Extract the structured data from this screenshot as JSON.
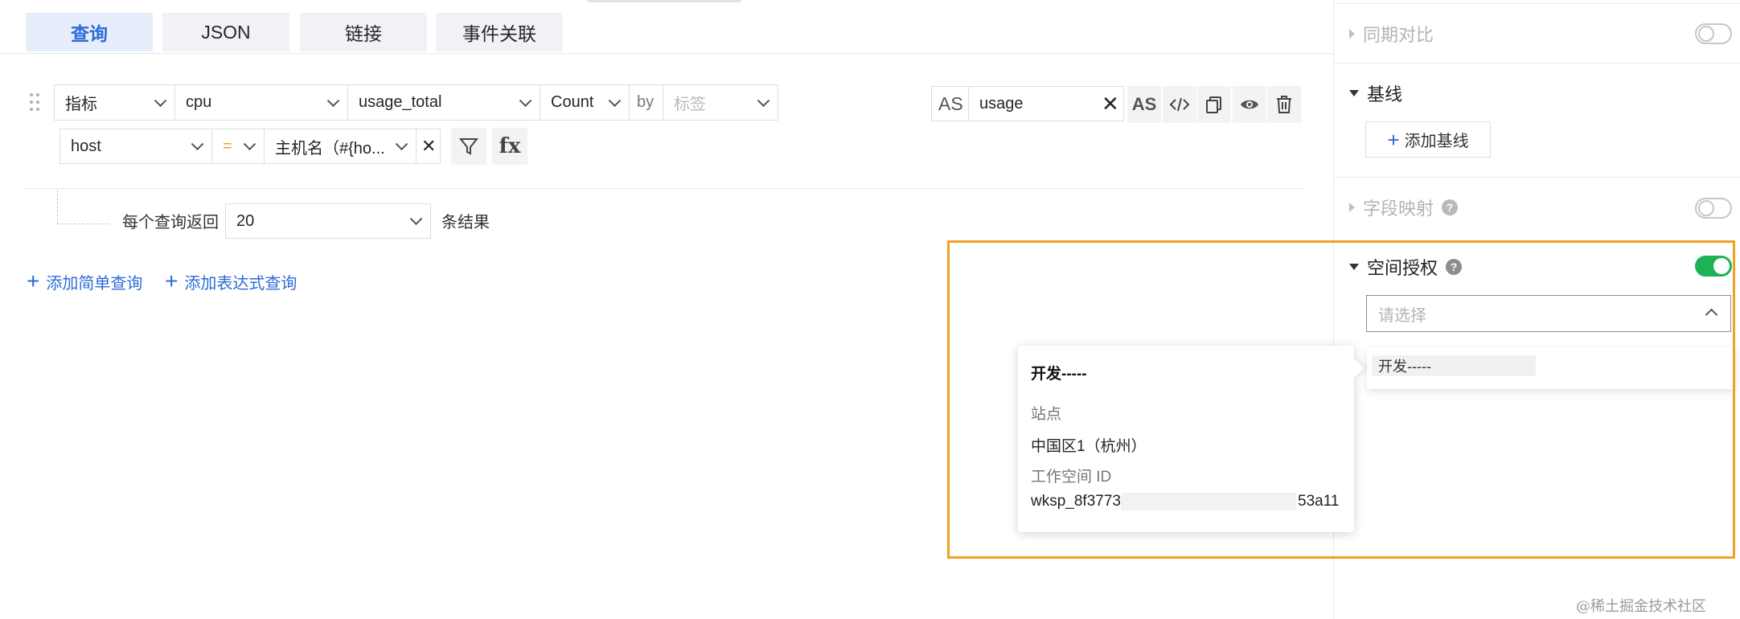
{
  "tabs": [
    {
      "label": "查询",
      "active": true
    },
    {
      "label": "JSON",
      "active": false
    },
    {
      "label": "链接",
      "active": false
    },
    {
      "label": "事件关联",
      "active": false
    }
  ],
  "query": {
    "type_select": "指标",
    "measurement_select": "cpu",
    "field_select": "usage_total",
    "aggregation_select": "Count",
    "by_label": "by",
    "tag_placeholder": "标签",
    "as_label": "AS",
    "alias_value": "usage",
    "filter": {
      "key": "host",
      "operator": "=",
      "value": "主机名（#{ho..."
    },
    "limit_label": "每个查询返回",
    "limit_value": "20",
    "limit_suffix": "条结果"
  },
  "toolbar_icons": [
    "as-toggle-icon",
    "code-icon",
    "copy-icon",
    "eye-icon",
    "trash-icon"
  ],
  "add_simple_query": "添加简单查询",
  "add_expression_query": "添加表达式查询",
  "right_panel": {
    "period_compare": "同期对比",
    "baseline": "基线",
    "add_baseline": "添加基线",
    "field_mapping": "字段映射",
    "space_auth": "空间授权",
    "space_auth_enabled": true,
    "select_placeholder": "请选择",
    "dropdown_option": "开发-----"
  },
  "popover": {
    "title": "开发-----",
    "site_label": "站点",
    "site_value": "中国区1（杭州）",
    "workspace_label": "工作空间 ID",
    "workspace_prefix": "wksp_8f3773",
    "workspace_suffix": "53a11"
  },
  "watermark": "@稀土掘金技术社区",
  "colors": {
    "accent": "#2d6bd6",
    "highlight": "#f0a11e",
    "toggle_on": "#1fb155",
    "operator": "#f0a11e"
  }
}
